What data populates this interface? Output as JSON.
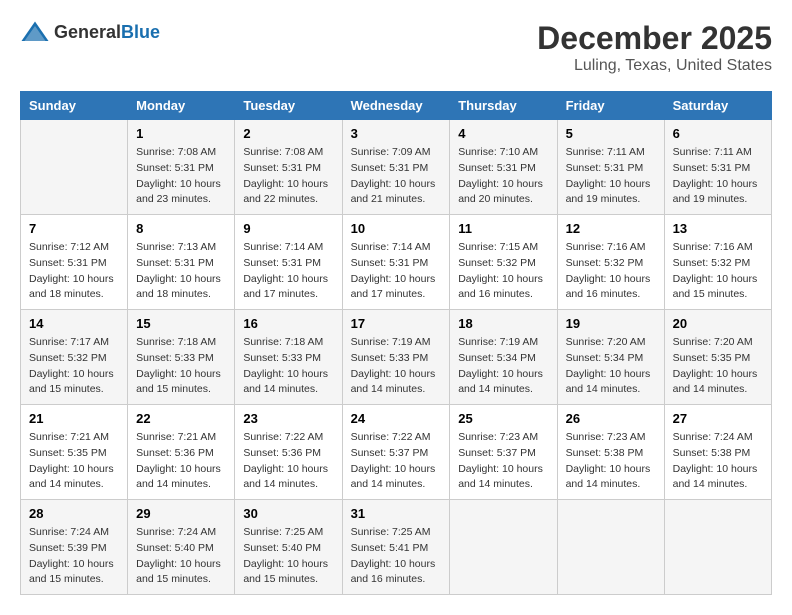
{
  "header": {
    "logo_general": "General",
    "logo_blue": "Blue",
    "month": "December 2025",
    "location": "Luling, Texas, United States"
  },
  "days_of_week": [
    "Sunday",
    "Monday",
    "Tuesday",
    "Wednesday",
    "Thursday",
    "Friday",
    "Saturday"
  ],
  "weeks": [
    [
      {
        "day": "",
        "info": ""
      },
      {
        "day": "1",
        "info": "Sunrise: 7:08 AM\nSunset: 5:31 PM\nDaylight: 10 hours\nand 23 minutes."
      },
      {
        "day": "2",
        "info": "Sunrise: 7:08 AM\nSunset: 5:31 PM\nDaylight: 10 hours\nand 22 minutes."
      },
      {
        "day": "3",
        "info": "Sunrise: 7:09 AM\nSunset: 5:31 PM\nDaylight: 10 hours\nand 21 minutes."
      },
      {
        "day": "4",
        "info": "Sunrise: 7:10 AM\nSunset: 5:31 PM\nDaylight: 10 hours\nand 20 minutes."
      },
      {
        "day": "5",
        "info": "Sunrise: 7:11 AM\nSunset: 5:31 PM\nDaylight: 10 hours\nand 19 minutes."
      },
      {
        "day": "6",
        "info": "Sunrise: 7:11 AM\nSunset: 5:31 PM\nDaylight: 10 hours\nand 19 minutes."
      }
    ],
    [
      {
        "day": "7",
        "info": "Sunrise: 7:12 AM\nSunset: 5:31 PM\nDaylight: 10 hours\nand 18 minutes."
      },
      {
        "day": "8",
        "info": "Sunrise: 7:13 AM\nSunset: 5:31 PM\nDaylight: 10 hours\nand 18 minutes."
      },
      {
        "day": "9",
        "info": "Sunrise: 7:14 AM\nSunset: 5:31 PM\nDaylight: 10 hours\nand 17 minutes."
      },
      {
        "day": "10",
        "info": "Sunrise: 7:14 AM\nSunset: 5:31 PM\nDaylight: 10 hours\nand 17 minutes."
      },
      {
        "day": "11",
        "info": "Sunrise: 7:15 AM\nSunset: 5:32 PM\nDaylight: 10 hours\nand 16 minutes."
      },
      {
        "day": "12",
        "info": "Sunrise: 7:16 AM\nSunset: 5:32 PM\nDaylight: 10 hours\nand 16 minutes."
      },
      {
        "day": "13",
        "info": "Sunrise: 7:16 AM\nSunset: 5:32 PM\nDaylight: 10 hours\nand 15 minutes."
      }
    ],
    [
      {
        "day": "14",
        "info": "Sunrise: 7:17 AM\nSunset: 5:32 PM\nDaylight: 10 hours\nand 15 minutes."
      },
      {
        "day": "15",
        "info": "Sunrise: 7:18 AM\nSunset: 5:33 PM\nDaylight: 10 hours\nand 15 minutes."
      },
      {
        "day": "16",
        "info": "Sunrise: 7:18 AM\nSunset: 5:33 PM\nDaylight: 10 hours\nand 14 minutes."
      },
      {
        "day": "17",
        "info": "Sunrise: 7:19 AM\nSunset: 5:33 PM\nDaylight: 10 hours\nand 14 minutes."
      },
      {
        "day": "18",
        "info": "Sunrise: 7:19 AM\nSunset: 5:34 PM\nDaylight: 10 hours\nand 14 minutes."
      },
      {
        "day": "19",
        "info": "Sunrise: 7:20 AM\nSunset: 5:34 PM\nDaylight: 10 hours\nand 14 minutes."
      },
      {
        "day": "20",
        "info": "Sunrise: 7:20 AM\nSunset: 5:35 PM\nDaylight: 10 hours\nand 14 minutes."
      }
    ],
    [
      {
        "day": "21",
        "info": "Sunrise: 7:21 AM\nSunset: 5:35 PM\nDaylight: 10 hours\nand 14 minutes."
      },
      {
        "day": "22",
        "info": "Sunrise: 7:21 AM\nSunset: 5:36 PM\nDaylight: 10 hours\nand 14 minutes."
      },
      {
        "day": "23",
        "info": "Sunrise: 7:22 AM\nSunset: 5:36 PM\nDaylight: 10 hours\nand 14 minutes."
      },
      {
        "day": "24",
        "info": "Sunrise: 7:22 AM\nSunset: 5:37 PM\nDaylight: 10 hours\nand 14 minutes."
      },
      {
        "day": "25",
        "info": "Sunrise: 7:23 AM\nSunset: 5:37 PM\nDaylight: 10 hours\nand 14 minutes."
      },
      {
        "day": "26",
        "info": "Sunrise: 7:23 AM\nSunset: 5:38 PM\nDaylight: 10 hours\nand 14 minutes."
      },
      {
        "day": "27",
        "info": "Sunrise: 7:24 AM\nSunset: 5:38 PM\nDaylight: 10 hours\nand 14 minutes."
      }
    ],
    [
      {
        "day": "28",
        "info": "Sunrise: 7:24 AM\nSunset: 5:39 PM\nDaylight: 10 hours\nand 15 minutes."
      },
      {
        "day": "29",
        "info": "Sunrise: 7:24 AM\nSunset: 5:40 PM\nDaylight: 10 hours\nand 15 minutes."
      },
      {
        "day": "30",
        "info": "Sunrise: 7:25 AM\nSunset: 5:40 PM\nDaylight: 10 hours\nand 15 minutes."
      },
      {
        "day": "31",
        "info": "Sunrise: 7:25 AM\nSunset: 5:41 PM\nDaylight: 10 hours\nand 16 minutes."
      },
      {
        "day": "",
        "info": ""
      },
      {
        "day": "",
        "info": ""
      },
      {
        "day": "",
        "info": ""
      }
    ]
  ]
}
